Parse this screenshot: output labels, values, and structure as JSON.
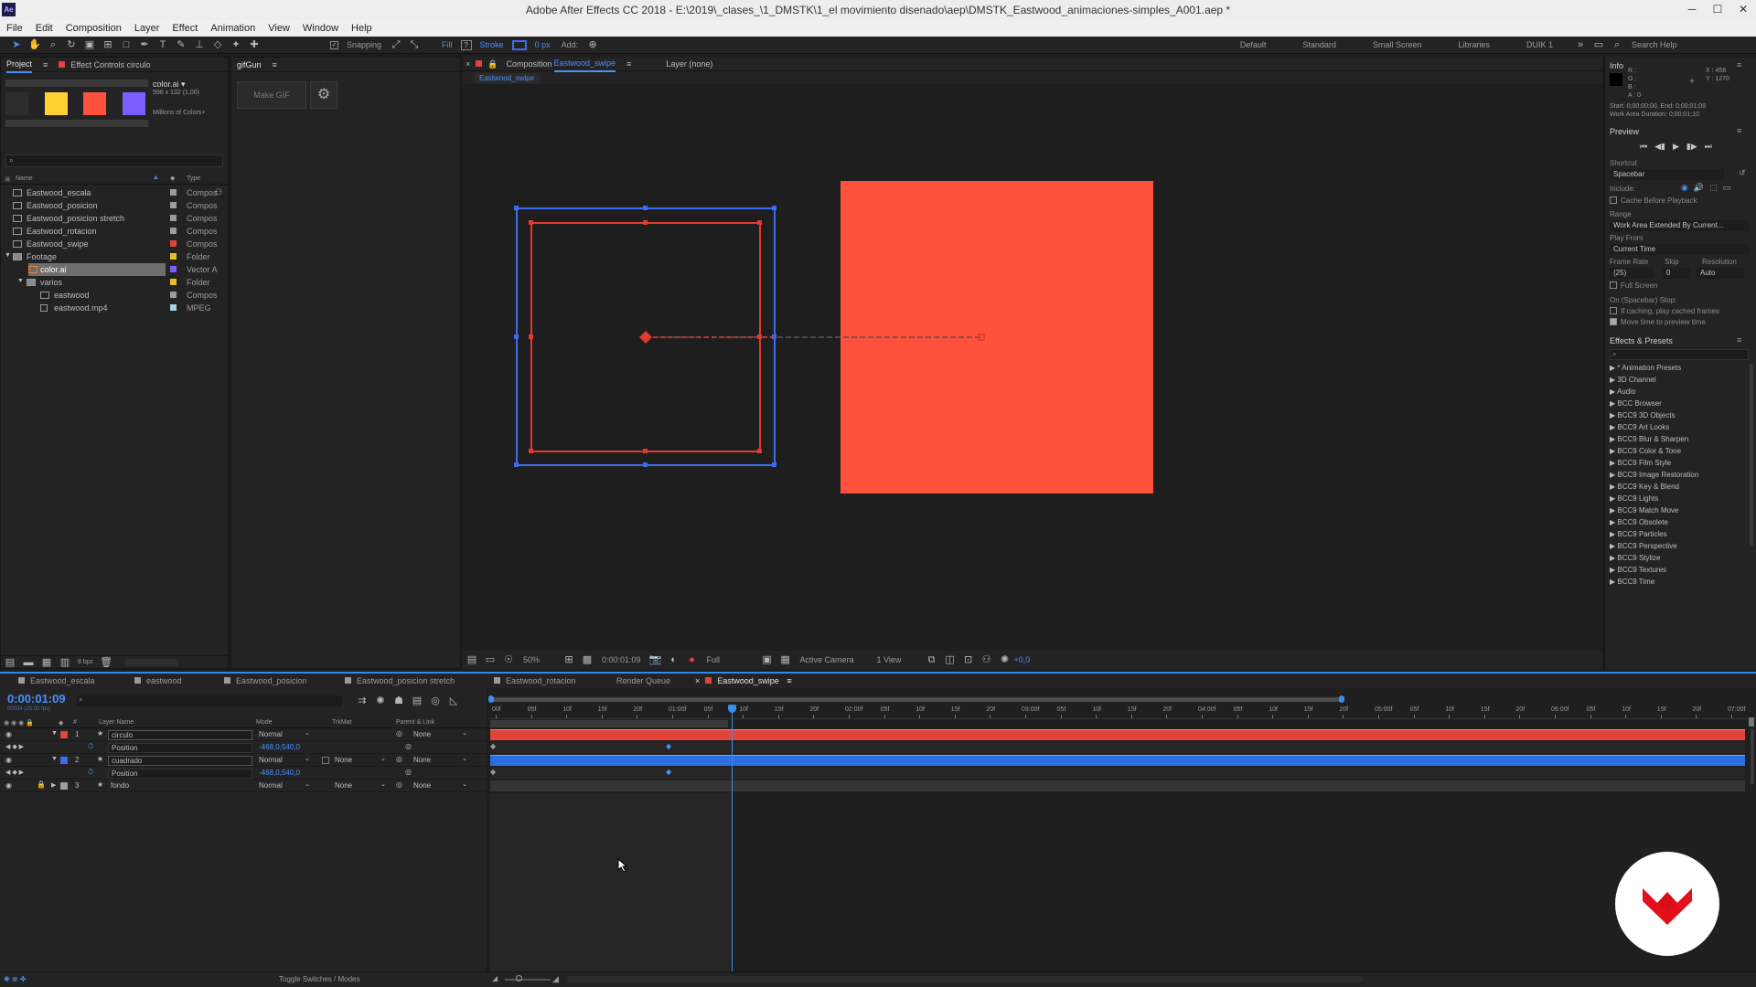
{
  "titlebar": {
    "app_icon": "Ae",
    "title": "Adobe After Effects CC 2018 - E:\\2019\\_clases_\\1_DMSTK\\1_el movimiento disenado\\aep\\DMSTK_Eastwood_animaciones-simples_A001.aep *",
    "minimize": "─",
    "maximize": "☐",
    "close": "✕"
  },
  "menu": [
    "File",
    "Edit",
    "Composition",
    "Layer",
    "Effect",
    "Animation",
    "View",
    "Window",
    "Help"
  ],
  "toolbar": {
    "snapping": "Snapping",
    "fill": "Fill",
    "stroke": "Stroke",
    "stroke_width": "0 px",
    "add": "Add:",
    "workspaces": [
      "Default",
      "Standard",
      "Small Screen",
      "Libraries",
      "DUIK 1"
    ],
    "search_help": "Search Help"
  },
  "project": {
    "tab_project": "Project",
    "tab_effect_controls": "Effect Controls circulo",
    "asset_name": "color.ai ▾",
    "asset_size": "596 x 132 (1,00)",
    "asset_colors": "Millions of Colors+",
    "swatches": [
      "#2d2d2d",
      "#ffd132",
      "#ff513c",
      "#7a5cff"
    ],
    "col_name": "Name",
    "col_type": "Type",
    "bpc": "8 bpc",
    "items": [
      {
        "name": "Eastwood_escala",
        "type": "Compos",
        "color": "#9c9c9c",
        "indent": 0,
        "kind": "comp"
      },
      {
        "name": "Eastwood_posicion",
        "type": "Compos",
        "color": "#9c9c9c",
        "indent": 0,
        "kind": "comp"
      },
      {
        "name": "Eastwood_posicion stretch",
        "type": "Compos",
        "color": "#9c9c9c",
        "indent": 0,
        "kind": "comp"
      },
      {
        "name": "Eastwood_rotacion",
        "type": "Compos",
        "color": "#9c9c9c",
        "indent": 0,
        "kind": "comp"
      },
      {
        "name": "Eastwood_swipe",
        "type": "Compos",
        "color": "#e0443a",
        "indent": 0,
        "kind": "comp"
      },
      {
        "name": "Footage",
        "type": "Folder",
        "color": "#e8c21f",
        "indent": 0,
        "kind": "folder"
      },
      {
        "name": "color.ai",
        "type": "Vector A",
        "color": "#7a5cff",
        "indent": 1,
        "kind": "file",
        "selected": true
      },
      {
        "name": "varios",
        "type": "Folder",
        "color": "#e8c21f",
        "indent": 1,
        "kind": "folder"
      },
      {
        "name": "eastwood",
        "type": "Compos",
        "color": "#9c9c9c",
        "indent": 2,
        "kind": "comp"
      },
      {
        "name": "eastwood.mp4",
        "type": "MPEG",
        "color": "#9fd4e8",
        "indent": 2,
        "kind": "file"
      }
    ]
  },
  "gifgun": {
    "title": "gifGun",
    "make_gif": "Make GIF"
  },
  "composition": {
    "tab_label": "Composition",
    "tab_name": "Eastwood_swipe",
    "layer_label": "Layer (none)",
    "breadcrumb": "Eastwood_swipe",
    "zoom": "50%",
    "timecode": "0:00:01:09",
    "resolution": "Full",
    "camera": "Active Camera",
    "views": "1 View",
    "exposure": "+0,0",
    "colors": {
      "shape": "#ff513c",
      "selection": "#3a6df0",
      "path": "#e23a2c"
    }
  },
  "info": {
    "title": "Info",
    "r": "R :",
    "g": "G :",
    "b": "B :",
    "a": "A : 0",
    "x": "X : 458",
    "y": "Y : 1270",
    "start_end": "Start: 0;00;00;00, End: 0;00;01;09",
    "work_area": "Work Area Duration: 0;00;01;10"
  },
  "preview": {
    "title": "Preview",
    "shortcut_label": "Shortcut",
    "shortcut": "Spacebar",
    "include": "Include:",
    "cache": "Cache Before Playback",
    "range_label": "Range",
    "range": "Work Area Extended By Current...",
    "play_from_label": "Play From",
    "play_from": "Current Time",
    "frame_rate_label": "Frame Rate",
    "skip_label": "Skip",
    "resolution_label": "Resolution",
    "frame_rate": "(25)",
    "skip": "0",
    "resolution": "Auto",
    "full_screen": "Full Screen",
    "stop_label": "On (Spacebar) Stop:",
    "if_caching": "If caching, play cached frames",
    "move_time": "Move time to preview time"
  },
  "effects": {
    "title": "Effects & Presets",
    "items": [
      "* Animation Presets",
      "3D Channel",
      "Audio",
      "BCC Browser",
      "BCC9 3D Objects",
      "BCC9 Art Looks",
      "BCC9 Blur & Sharpen",
      "BCC9 Color & Tone",
      "BCC9 Film Style",
      "BCC9 Image Restoration",
      "BCC9 Key & Blend",
      "BCC9 Lights",
      "BCC9 Match Move",
      "BCC9 Obsolete",
      "BCC9 Particles",
      "BCC9 Perspective",
      "BCC9 Stylize",
      "BCC9 Textures",
      "BCC9 Time"
    ]
  },
  "timeline": {
    "tabs": [
      {
        "name": "Eastwood_escala",
        "active": false
      },
      {
        "name": "eastwood",
        "active": false
      },
      {
        "name": "Eastwood_posicion",
        "active": false
      },
      {
        "name": "Eastwood_posicion stretch",
        "active": false
      },
      {
        "name": "Eastwood_rotacion",
        "active": false
      },
      {
        "name": "Render Queue",
        "active": false
      },
      {
        "name": "Eastwood_swipe",
        "active": true
      }
    ],
    "current_time": "0:00:01:09",
    "fps_note": "00034 (25.00 fps)",
    "col_layer_name": "Layer Name",
    "col_mode": "Mode",
    "col_trkmat": "TrkMat",
    "col_parent": "Parent & Link",
    "ruler": [
      "00f",
      "05f",
      "10f",
      "15f",
      "20f",
      "01:00f",
      "05f",
      "10f",
      "15f",
      "20f",
      "02:00f",
      "05f",
      "10f",
      "15f",
      "20f",
      "03:00f",
      "05f",
      "10f",
      "15f",
      "20f",
      "04:00f",
      "05f",
      "10f",
      "15f",
      "20f",
      "05:00f",
      "05f",
      "10f",
      "15f",
      "20f",
      "06:00f",
      "05f",
      "10f",
      "15f",
      "20f",
      "07:00f"
    ],
    "layers": [
      {
        "num": "1",
        "name": "circulo",
        "mode": "Normal",
        "trkmat": "",
        "parent": "None",
        "color": "#e0443a",
        "position": "-468,0,540,0"
      },
      {
        "num": "2",
        "name": "cuadrado",
        "mode": "Normal",
        "trkmat": "None",
        "parent": "None",
        "color": "#3a6df0",
        "position": "-468,0,540,0"
      },
      {
        "num": "3",
        "name": "fondo",
        "mode": "Normal",
        "trkmat": "None",
        "parent": "None",
        "color": "#9c9c9c"
      }
    ],
    "position_label": "Position",
    "toggle": "Toggle Switches / Modes",
    "colors": {
      "red_bar": "#e0443a",
      "blue_bar": "#2a6fe0",
      "playhead": "#3a8ef0"
    }
  }
}
